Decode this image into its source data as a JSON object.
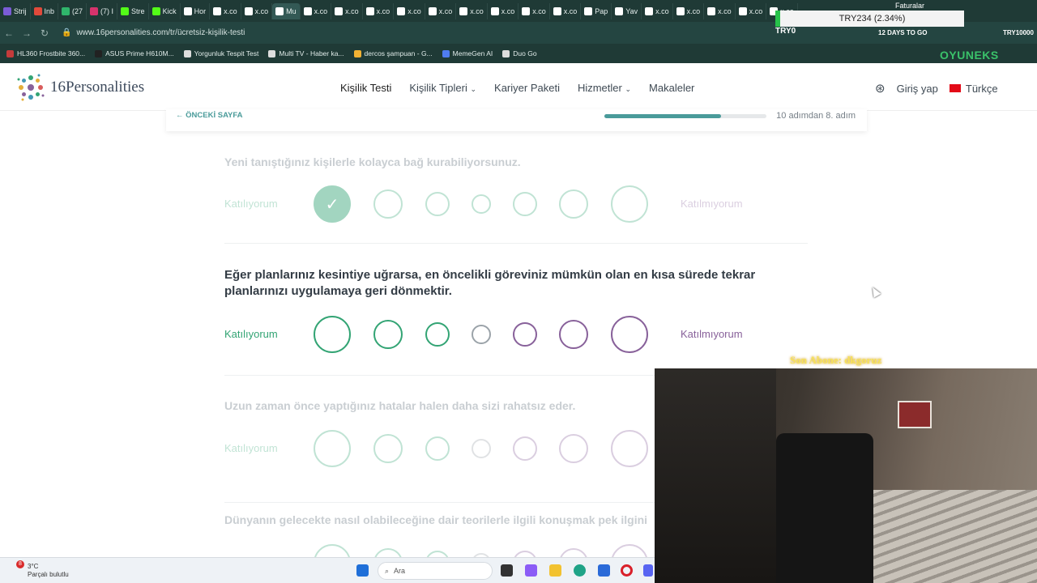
{
  "browser": {
    "tabs": [
      {
        "label": "Strij",
        "color": "#7b5cd6"
      },
      {
        "label": "Inb",
        "color": "#e24a3b"
      },
      {
        "label": "(27",
        "color": "#2fb56b"
      },
      {
        "label": "(7) I",
        "color": "#d6336c"
      },
      {
        "label": "Stre",
        "color": "#53fc18"
      },
      {
        "label": "Kick",
        "color": "#53fc18"
      },
      {
        "label": "Hor",
        "color": "#ffffff"
      },
      {
        "label": "x.co",
        "color": "#ffffff"
      },
      {
        "label": "x.co",
        "color": "#ffffff"
      },
      {
        "label": "Mu",
        "color": "#ffffff",
        "active": true
      },
      {
        "label": "x.co",
        "color": "#ffffff"
      },
      {
        "label": "x.co",
        "color": "#ffffff"
      },
      {
        "label": "x.co",
        "color": "#ffffff"
      },
      {
        "label": "x.co",
        "color": "#ffffff"
      },
      {
        "label": "x.co",
        "color": "#ffffff"
      },
      {
        "label": "x.co",
        "color": "#ffffff"
      },
      {
        "label": "x.co",
        "color": "#ffffff"
      },
      {
        "label": "x.co",
        "color": "#ffffff"
      },
      {
        "label": "x.co",
        "color": "#ffffff"
      },
      {
        "label": "Pap",
        "color": "#ffffff"
      },
      {
        "label": "Yav",
        "color": "#ffffff"
      },
      {
        "label": "x.co",
        "color": "#ffffff"
      },
      {
        "label": "x.co",
        "color": "#ffffff"
      },
      {
        "label": "x.co",
        "color": "#ffffff"
      },
      {
        "label": "x.co",
        "color": "#ffffff"
      },
      {
        "label": "x.co",
        "color": "#ffffff"
      }
    ],
    "url": "www.16personalities.com/tr/ücretsiz-kişilik-testi",
    "bookmarks": [
      {
        "label": "HL360 Frostbite 360...",
        "color": "#c43b3b"
      },
      {
        "label": "ASUS Prime H610M...",
        "color": "#222222"
      },
      {
        "label": "Yorgunluk Tespit Test",
        "color": "#dddddd"
      },
      {
        "label": "Multi TV - Haber ka...",
        "color": "#dddddd"
      },
      {
        "label": "dercos şampuan - G...",
        "color": "#f2b233"
      },
      {
        "label": "MemeGen AI",
        "color": "#4f7cf0"
      },
      {
        "label": "Duo Go",
        "color": "#dddddd"
      }
    ]
  },
  "overlay": {
    "faturalar": "Faturalar",
    "ticker_main": "TRY234 (2.34%)",
    "ticker_left": "TRY0",
    "ticker_days": "12 DAYS TO GO",
    "ticker_right": "TRY10000",
    "brand": "OYUNEKS",
    "last_follower": "Son Abone: dkgoruz"
  },
  "site": {
    "logo_text": "16Personalities",
    "nav": [
      "Kişilik Testi",
      "Kişilik Tipleri",
      "Kariyer Paketi",
      "Hizmetler",
      "Makaleler"
    ],
    "login": "Giriş yap",
    "language": "Türkçe",
    "prev_page": "ÖNCEKİ SAYFA",
    "step_text": "10 adımdan 8. adım",
    "progress_fraction": 0.72
  },
  "questions": [
    {
      "text": "Yeni tanıştığınız kişilerle kolayca bağ kurabiliyorsunuz.",
      "state": "answered",
      "selected": 0
    },
    {
      "text": "Eğer planlarınız kesintiye uğrarsa, en öncelikli göreviniz mümkün olan en kısa sürede tekrar planlarınızı uygulamaya geri dönmektir.",
      "state": "active"
    },
    {
      "text": "Uzun zaman önce yaptığınız hatalar halen daha sizi rahatsız eder.",
      "state": "upcoming"
    },
    {
      "text": "Dünyanın gelecekte nasıl olabileceğine dair teorilerle ilgili konuşmak pek ilgini",
      "state": "upcoming"
    }
  ],
  "scale": {
    "agree": "Katılıyorum",
    "disagree": "Katılmıyorum"
  },
  "taskbar": {
    "temperature": "3°C",
    "weather": "Parçalı bulutlu",
    "badge": "8",
    "search_placeholder": "Ara"
  }
}
